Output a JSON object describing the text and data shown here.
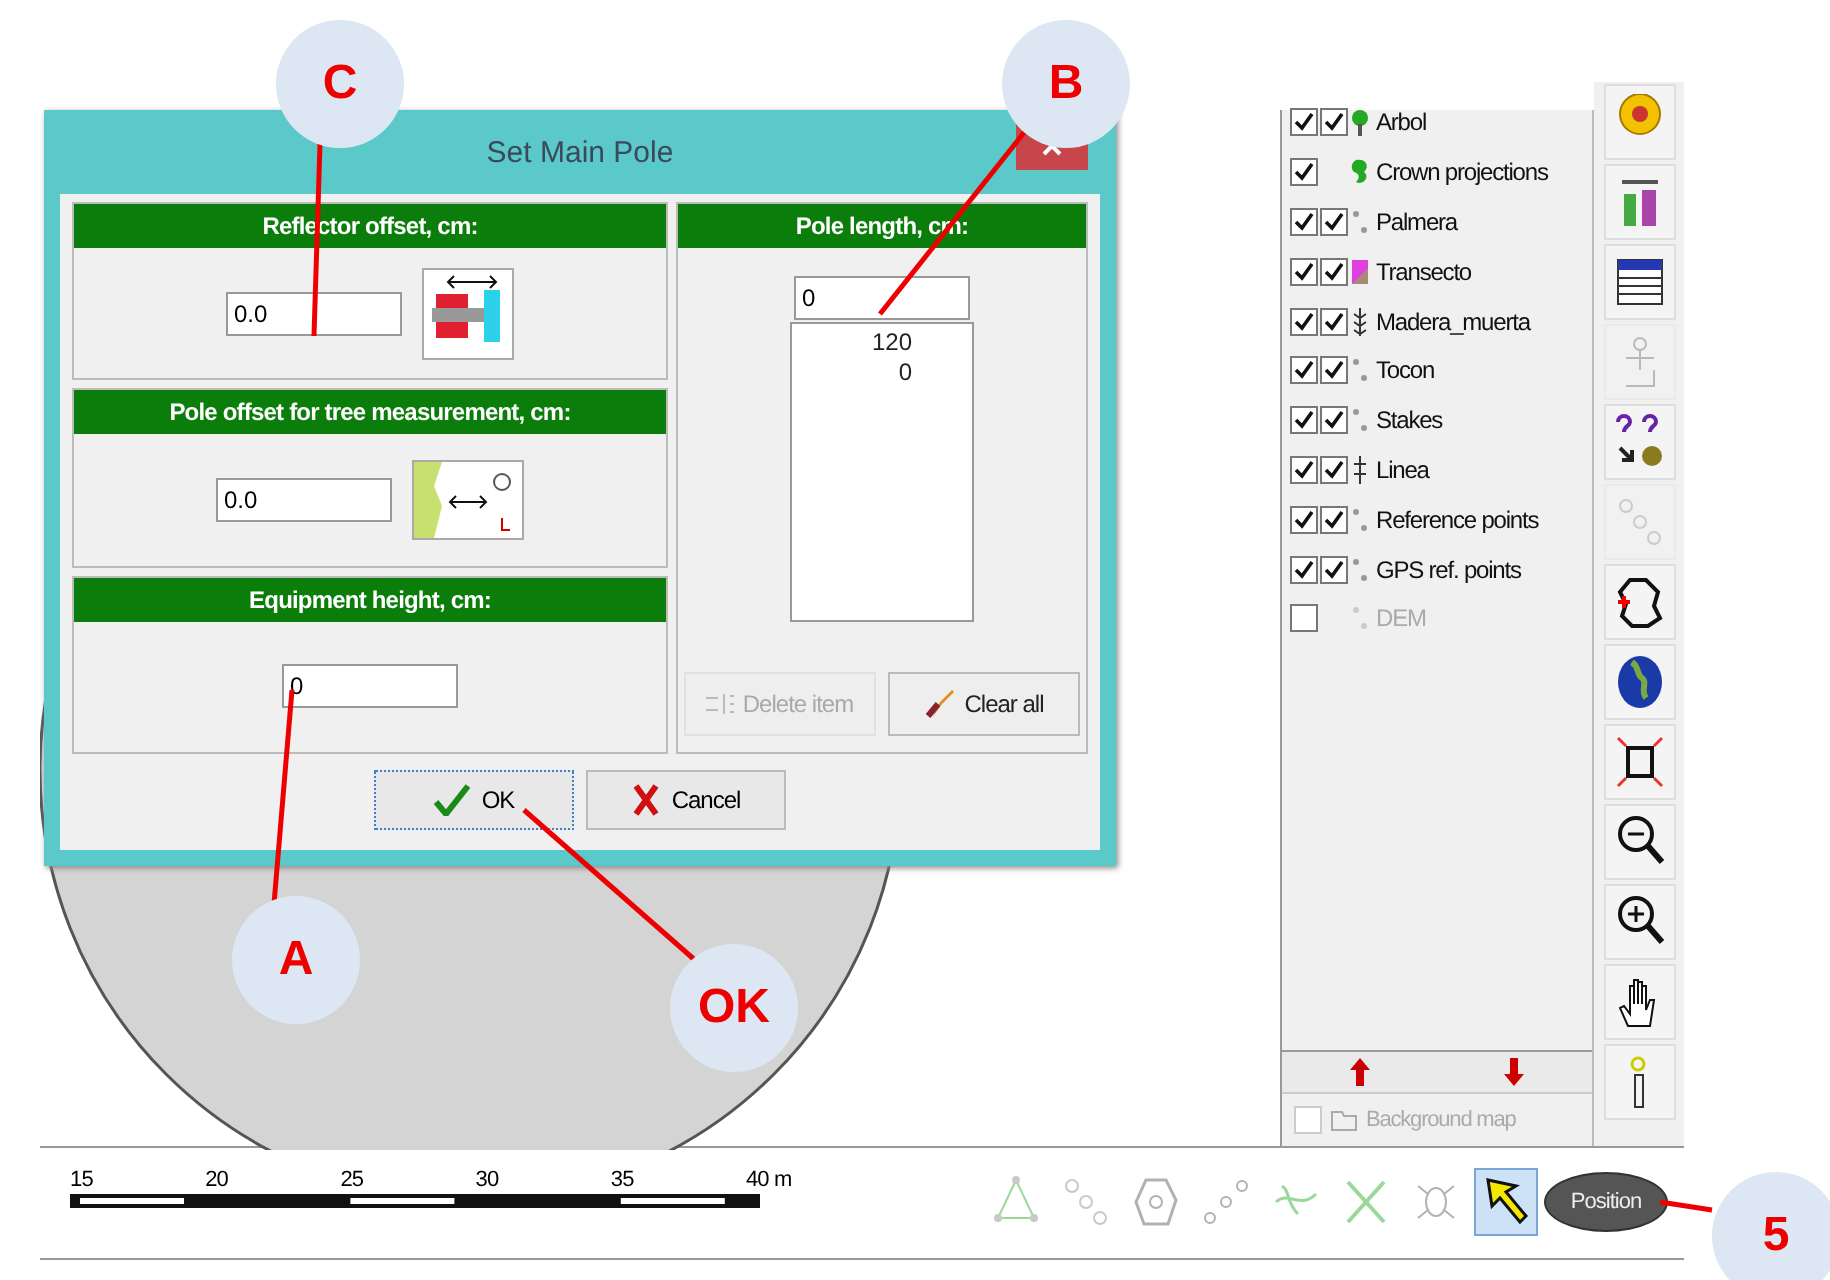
{
  "dialog": {
    "title": "Set Main Pole",
    "groups": [
      {
        "heading": "Reflector offset, cm:",
        "value": "0.0",
        "kind": "reflector"
      },
      {
        "heading": "Pole offset for tree measurement, cm:",
        "value": "0.0",
        "kind": "tree"
      },
      {
        "heading": "Equipment height, cm:",
        "value": "0",
        "kind": "none"
      }
    ],
    "pole_length": {
      "heading": "Pole length, cm:",
      "value": "0",
      "items": [
        "120",
        "0"
      ]
    },
    "list_buttons": [
      {
        "label": "Delete item",
        "kind": "delete",
        "disabled": true
      },
      {
        "label": "Clear all",
        "kind": "clear",
        "disabled": false
      }
    ],
    "buttons": [
      {
        "label": "OK",
        "kind": "ok",
        "focused": true
      },
      {
        "label": "Cancel",
        "kind": "cancel",
        "focused": false
      }
    ]
  },
  "layers": [
    {
      "name": "Arbol",
      "kind": "tree",
      "checks": [
        {
          "checked": true
        },
        {
          "checked": true
        }
      ],
      "disabled": false
    },
    {
      "name": "Crown projections",
      "kind": "crown",
      "checks": [
        {
          "checked": true
        }
      ],
      "disabled": false
    },
    {
      "name": "Palmera",
      "kind": "points",
      "checks": [
        {
          "checked": true
        },
        {
          "checked": true
        }
      ],
      "disabled": false
    },
    {
      "name": "Transecto",
      "kind": "transect",
      "checks": [
        {
          "checked": true
        },
        {
          "checked": true
        }
      ],
      "disabled": false
    },
    {
      "name": "Madera_muerta",
      "kind": "deadwood",
      "checks": [
        {
          "checked": true
        },
        {
          "checked": true
        }
      ],
      "disabled": false
    },
    {
      "name": "Tocon",
      "kind": "points",
      "checks": [
        {
          "checked": true
        },
        {
          "checked": true
        }
      ],
      "disabled": false
    },
    {
      "name": "Stakes",
      "kind": "points",
      "checks": [
        {
          "checked": true
        },
        {
          "checked": true
        }
      ],
      "disabled": false
    },
    {
      "name": "Linea",
      "kind": "line",
      "checks": [
        {
          "checked": true
        },
        {
          "checked": true
        }
      ],
      "disabled": false
    },
    {
      "name": "Reference points",
      "kind": "points",
      "checks": [
        {
          "checked": true
        },
        {
          "checked": true
        }
      ],
      "disabled": false
    },
    {
      "name": "GPS ref. points",
      "kind": "points",
      "checks": [
        {
          "checked": true
        },
        {
          "checked": true
        }
      ],
      "disabled": false
    },
    {
      "name": "DEM",
      "kind": "points",
      "checks": [
        {
          "checked": false
        }
      ],
      "disabled": true
    }
  ],
  "background_map": {
    "label": "Background map",
    "checked": false,
    "disabled": true
  },
  "toolbar": [
    {
      "kind": "target",
      "disabled": false
    },
    {
      "kind": "bottles",
      "disabled": false
    },
    {
      "kind": "table",
      "disabled": false
    },
    {
      "kind": "person",
      "disabled": true
    },
    {
      "kind": "query",
      "disabled": false
    },
    {
      "kind": "chain",
      "disabled": true
    },
    {
      "kind": "polygon",
      "disabled": false
    },
    {
      "kind": "globe",
      "disabled": false
    },
    {
      "kind": "extent",
      "disabled": false
    },
    {
      "kind": "zoom-out",
      "disabled": false
    },
    {
      "kind": "zoom-in",
      "disabled": false
    },
    {
      "kind": "hand",
      "disabled": false
    },
    {
      "kind": "pole",
      "disabled": false
    }
  ],
  "scale": {
    "labels": [
      "15",
      "20",
      "25",
      "30",
      "35",
      "40 m"
    ]
  },
  "bottom_tools": [
    {
      "kind": "triangle",
      "selected": false,
      "disabled": true
    },
    {
      "kind": "chain",
      "selected": false,
      "disabled": true
    },
    {
      "kind": "blob",
      "selected": false,
      "disabled": true
    },
    {
      "kind": "dots",
      "selected": false,
      "disabled": true
    },
    {
      "kind": "curve",
      "selected": false,
      "disabled": true
    },
    {
      "kind": "cross",
      "selected": false,
      "disabled": true
    },
    {
      "kind": "bug",
      "selected": false,
      "disabled": true
    },
    {
      "kind": "arrow",
      "selected": true,
      "disabled": false
    }
  ],
  "position_button": {
    "label": "Position"
  },
  "callouts": [
    {
      "label": "C"
    },
    {
      "label": "B"
    },
    {
      "label": "A"
    },
    {
      "label": "OK"
    },
    {
      "label": "5"
    }
  ]
}
